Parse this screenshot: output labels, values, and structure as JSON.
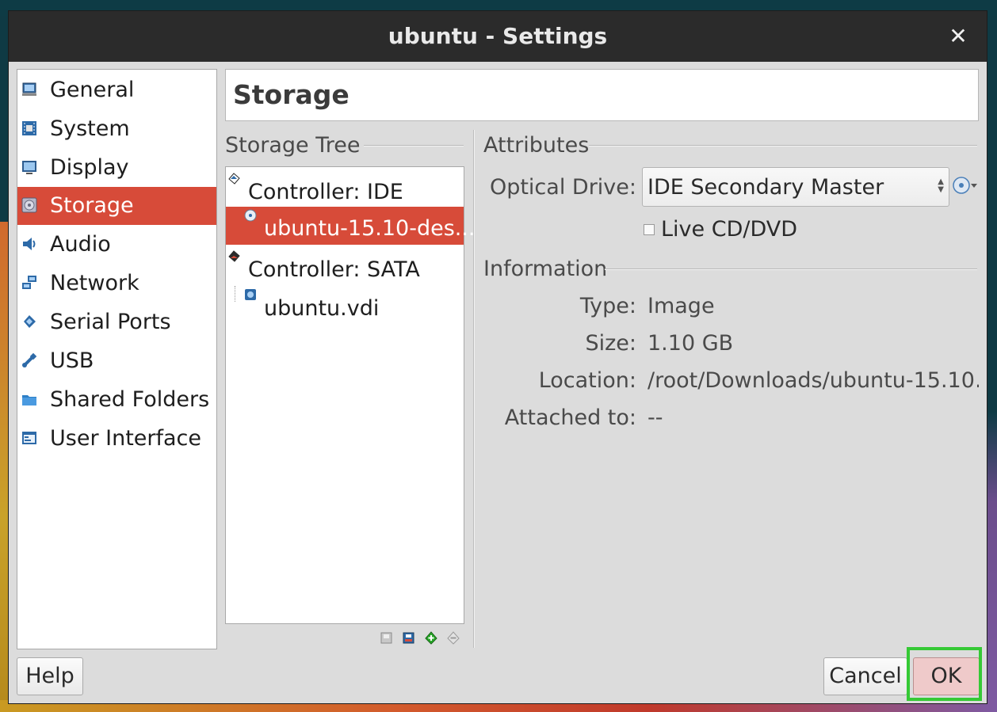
{
  "window": {
    "title": "ubuntu - Settings"
  },
  "sidebar": {
    "items": [
      {
        "label": "General",
        "icon": "monitor-icon",
        "active": false
      },
      {
        "label": "System",
        "icon": "chip-icon",
        "active": false
      },
      {
        "label": "Display",
        "icon": "display-icon",
        "active": false
      },
      {
        "label": "Storage",
        "icon": "disk-icon",
        "active": true
      },
      {
        "label": "Audio",
        "icon": "speaker-icon",
        "active": false
      },
      {
        "label": "Network",
        "icon": "network-icon",
        "active": false
      },
      {
        "label": "Serial Ports",
        "icon": "serial-port-icon",
        "active": false
      },
      {
        "label": "USB",
        "icon": "usb-icon",
        "active": false
      },
      {
        "label": "Shared Folders",
        "icon": "folder-icon",
        "active": false
      },
      {
        "label": "User Interface",
        "icon": "window-icon",
        "active": false
      }
    ]
  },
  "header": {
    "title": "Storage"
  },
  "storage_tree": {
    "group_label": "Storage Tree",
    "rows": [
      {
        "label": "Controller: IDE",
        "type": "controller"
      },
      {
        "label": "ubuntu-15.10-des...",
        "type": "optical",
        "selected": true
      },
      {
        "label": "Controller: SATA",
        "type": "controller"
      },
      {
        "label": "ubuntu.vdi",
        "type": "harddisk"
      }
    ],
    "tools": [
      "remove-attachment-icon",
      "add-harddisk-icon",
      "add-controller-icon",
      "remove-controller-icon"
    ]
  },
  "attributes": {
    "group_label": "Attributes",
    "optical_drive_label": "Optical Drive:",
    "optical_drive_value": "IDE Secondary Master",
    "live_cd_label": "Live CD/DVD",
    "live_cd_checked": false
  },
  "information": {
    "group_label": "Information",
    "type_label": "Type:",
    "type_value": "Image",
    "size_label": "Size:",
    "size_value": "1.10 GB",
    "location_label": "Location:",
    "location_value": "/root/Downloads/ubuntu-15.10…",
    "attached_label": "Attached to:",
    "attached_value": "--"
  },
  "buttons": {
    "help": "Help",
    "cancel": "Cancel",
    "ok": "OK"
  },
  "colors": {
    "accent": "#d74b39",
    "title_bar": "#2b2b2b",
    "window_bg": "#dcdcdc",
    "highlight": "#35c935"
  }
}
